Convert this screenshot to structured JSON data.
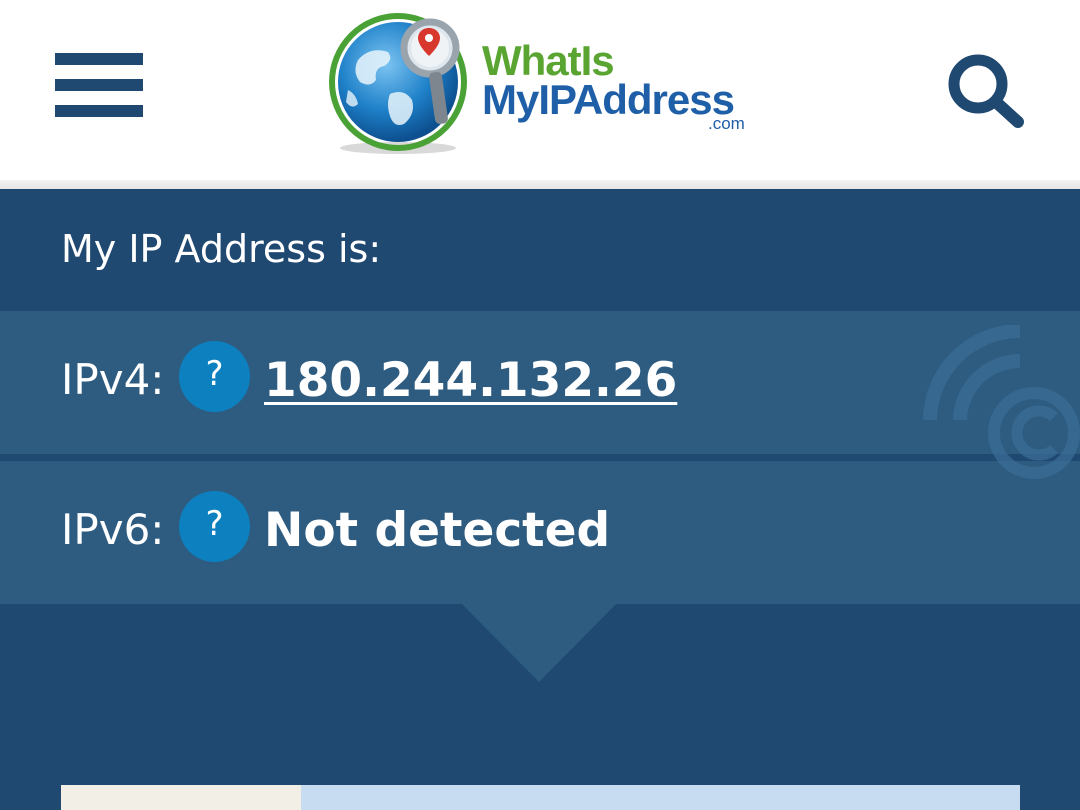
{
  "header": {
    "logo": {
      "line1": "WhatIs",
      "line2": "MyIPAddress",
      "line3": ".com"
    },
    "menu_icon": "hamburger-menu-icon",
    "search_icon": "search-icon"
  },
  "ip_info": {
    "heading": "My IP Address is:",
    "rows": [
      {
        "label": "IPv4:",
        "help": "?",
        "value": "180.244.132.26"
      },
      {
        "label": "IPv6:",
        "help": "?",
        "value": "Not detected"
      }
    ]
  },
  "colors": {
    "header_bg": "#ffffff",
    "panel_bg": "#204972",
    "row_bg": "#2e5c81",
    "help_badge": "#0d80c0",
    "logo_green": "#5aa532",
    "logo_blue": "#1f5fa7"
  }
}
